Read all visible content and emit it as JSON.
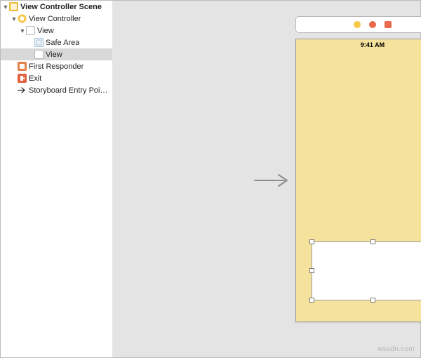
{
  "outline": {
    "scene": {
      "label": "View Controller Scene"
    },
    "viewController": {
      "label": "View Controller"
    },
    "rootView": {
      "label": "View"
    },
    "safeArea": {
      "label": "Safe Area"
    },
    "childView": {
      "label": "View"
    },
    "firstResponder": {
      "label": "First Responder"
    },
    "exit": {
      "label": "Exit"
    },
    "entryPoint": {
      "label": "Storyboard Entry Poi…"
    }
  },
  "statusbar": {
    "time": "9:41 AM"
  },
  "colors": {
    "canvasBg": "#e4e4e4",
    "phoneBg": "#f5e29c",
    "accentYellow": "#f7c948",
    "accentOrange": "#ec6a4c"
  },
  "watermark": "wsxdn.com"
}
